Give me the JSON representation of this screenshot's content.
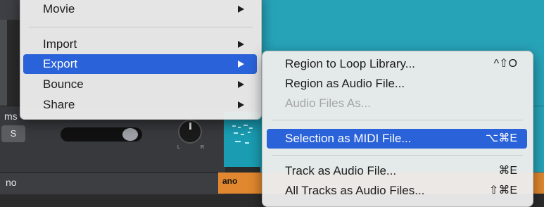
{
  "main_menu": {
    "items": [
      {
        "label": "Movie"
      },
      {
        "label": "Import"
      },
      {
        "label": "Export"
      },
      {
        "label": "Bounce"
      },
      {
        "label": "Share"
      }
    ]
  },
  "export_submenu": {
    "items": [
      {
        "label": "Region to Loop Library...",
        "shortcut": "^⇧O"
      },
      {
        "label": "Region as Audio File...",
        "shortcut": ""
      },
      {
        "label": "Audio Files As...",
        "shortcut": ""
      },
      {
        "label": "Selection as MIDI File...",
        "shortcut": "⌥⌘E"
      },
      {
        "label": "Track as Audio File...",
        "shortcut": "⌘E"
      },
      {
        "label": "All Tracks as Audio Files...",
        "shortcut": "⇧⌘E"
      }
    ]
  },
  "background": {
    "track_label_1": "ms",
    "track_label_2": "no",
    "solo_button": "S",
    "region_label": "ano",
    "pan_left": "L",
    "pan_right": "R"
  }
}
